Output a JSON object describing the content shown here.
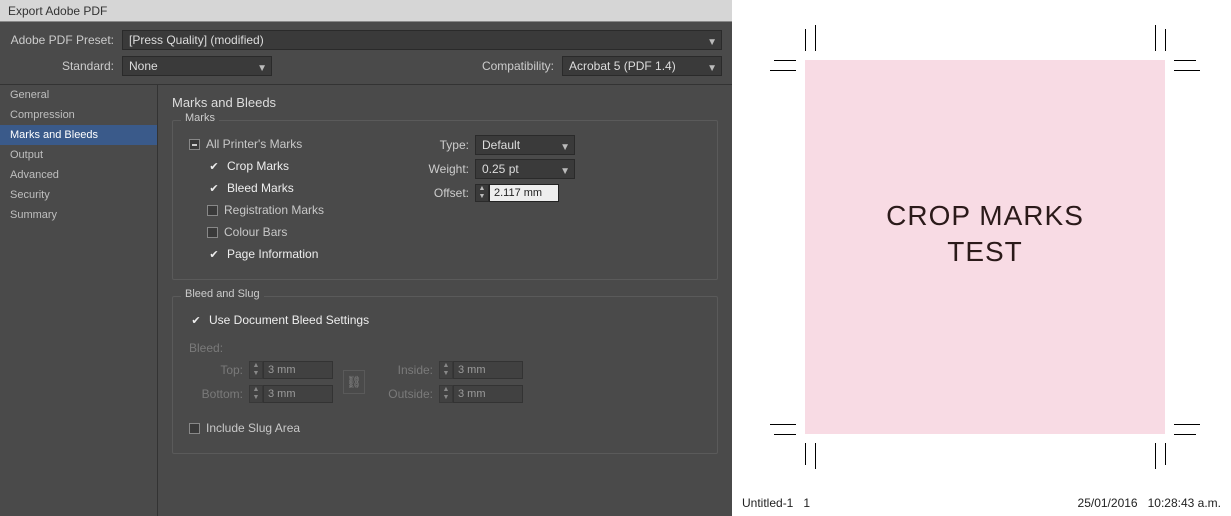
{
  "window": {
    "title": "Export Adobe PDF"
  },
  "preset": {
    "label": "Adobe PDF Preset:",
    "value": "[Press Quality] (modified)"
  },
  "standard": {
    "label": "Standard:",
    "value": "None"
  },
  "compat": {
    "label": "Compatibility:",
    "value": "Acrobat 5 (PDF 1.4)"
  },
  "sidebar": {
    "items": [
      "General",
      "Compression",
      "Marks and Bleeds",
      "Output",
      "Advanced",
      "Security",
      "Summary"
    ],
    "selected": 2
  },
  "panel": {
    "title": "Marks and Bleeds"
  },
  "marks": {
    "legend": "Marks",
    "all": "All Printer's Marks",
    "crop": "Crop Marks",
    "bleed": "Bleed Marks",
    "reg": "Registration Marks",
    "color": "Colour Bars",
    "page": "Page Information",
    "type_label": "Type:",
    "type_value": "Default",
    "weight_label": "Weight:",
    "weight_value": "0.25 pt",
    "offset_label": "Offset:",
    "offset_value": "2.117 mm"
  },
  "bleed": {
    "legend": "Bleed and Slug",
    "use_doc": "Use Document Bleed Settings",
    "bleed_label": "Bleed:",
    "top_label": "Top:",
    "bottom_label": "Bottom:",
    "inside_label": "Inside:",
    "outside_label": "Outside:",
    "top": "3 mm",
    "bottom": "3 mm",
    "inside": "3 mm",
    "outside": "3 mm",
    "slug": "Include Slug Area"
  },
  "preview": {
    "line1": "CROP MARKS",
    "line2": "TEST",
    "docname": "Untitled-1",
    "pagenum": "1",
    "date": "25/01/2016",
    "time": "10:28:43 a.m."
  }
}
